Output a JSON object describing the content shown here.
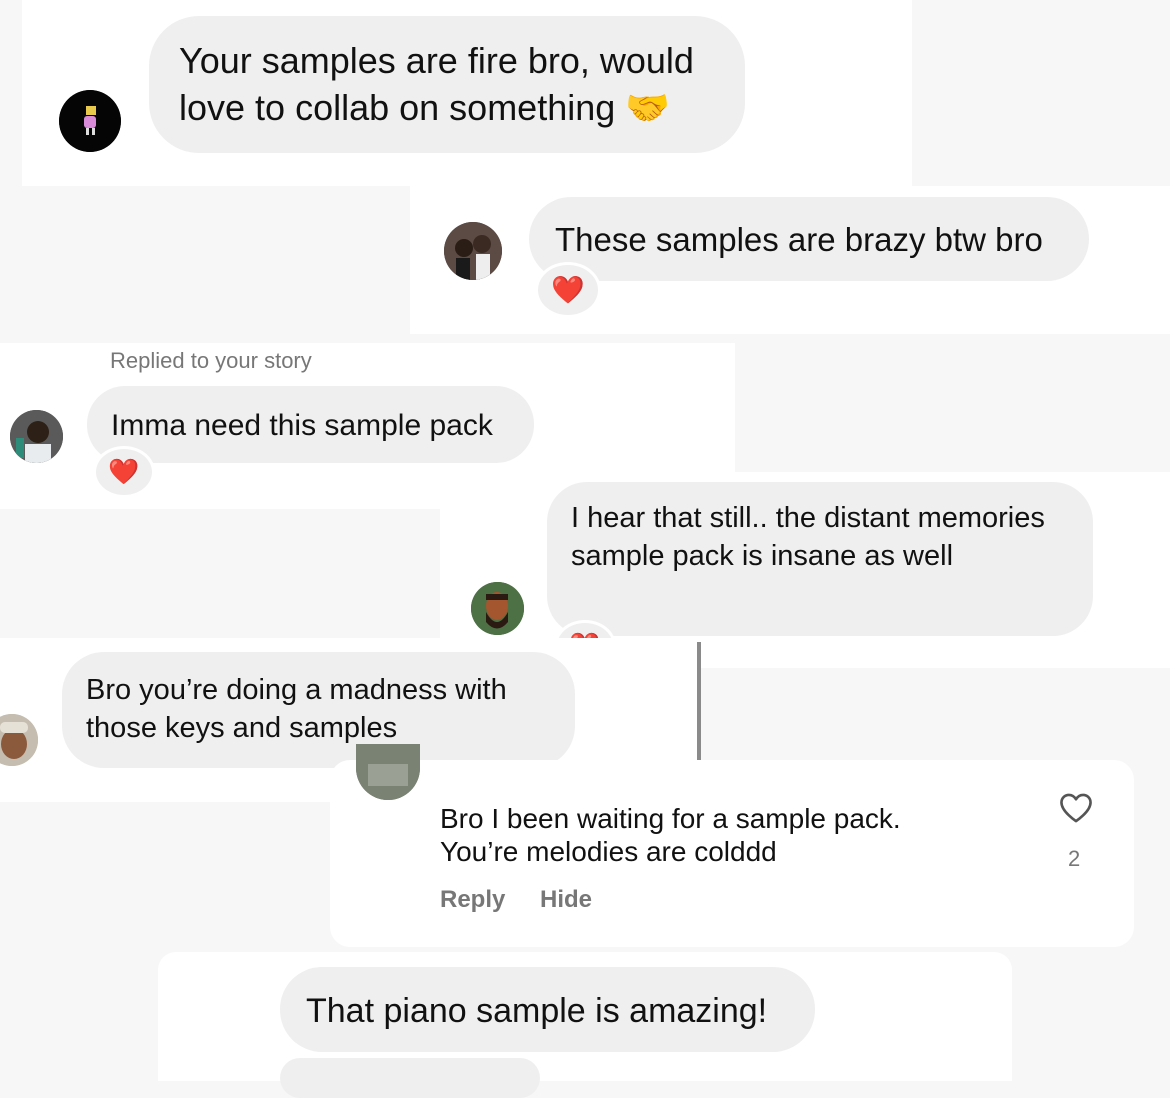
{
  "messages": [
    {
      "text": "Your samples are fire bro, would love to collab on something",
      "emoji": "🤝"
    },
    {
      "text": "These samples are brazy btw bro",
      "reaction": "❤️"
    },
    {
      "context": "Replied to your story",
      "text": "Imma need this sample pack",
      "reaction": "❤️"
    },
    {
      "text": "I hear that still.. the distant memories sample pack is insane as well",
      "reaction": "❤️"
    },
    {
      "text": "Bro you’re doing a madness with those keys and samples"
    },
    {
      "text": "That piano sample is amazing!"
    }
  ],
  "comment": {
    "text_line1": "Bro I been waiting for a sample pack.",
    "text_line2": "You’re melodies are colddd",
    "reply_label": "Reply",
    "hide_label": "Hide",
    "like_count": "2"
  },
  "icons": {
    "heart_reaction": "heart-reaction-icon",
    "like": "heart-outline-icon"
  }
}
